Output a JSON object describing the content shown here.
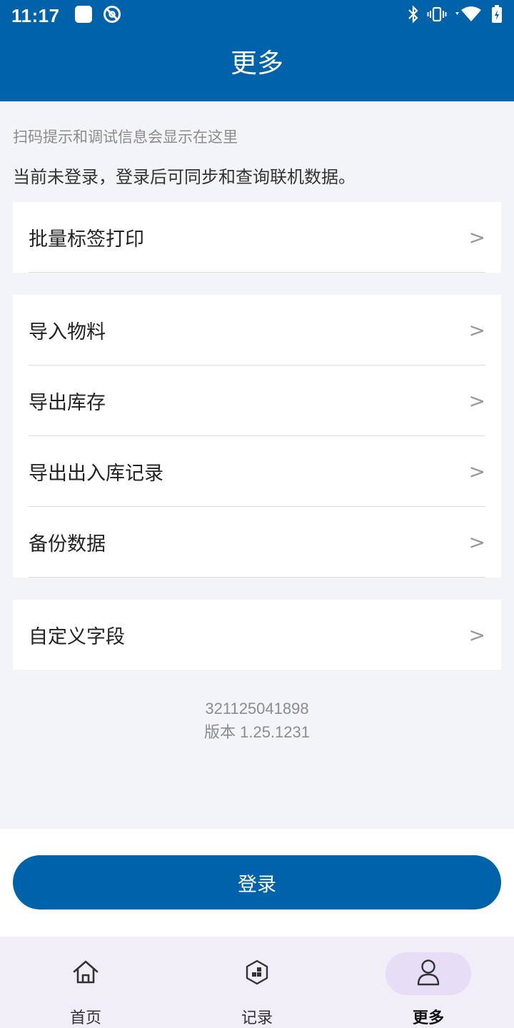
{
  "status_bar": {
    "time": "11:17"
  },
  "header": {
    "title": "更多"
  },
  "hint_text": "扫码提示和调试信息会显示在这里",
  "login_status": "当前未登录，登录后可同步和查询联机数据。",
  "chevron": ">",
  "groups": {
    "print": [
      {
        "label": "批量标签打印"
      }
    ],
    "data": [
      {
        "label": "导入物料"
      },
      {
        "label": "导出库存"
      },
      {
        "label": "导出出入库记录"
      },
      {
        "label": "备份数据"
      }
    ],
    "fields": [
      {
        "label": "自定义字段"
      }
    ]
  },
  "device_id": "321125041898",
  "version": "版本 1.25.1231",
  "login_button": "登录",
  "bottom_nav": [
    {
      "label": "首页",
      "icon": "home-icon"
    },
    {
      "label": "记录",
      "icon": "records-icon"
    },
    {
      "label": "更多",
      "icon": "person-icon",
      "active": true
    }
  ],
  "colors": {
    "primary": "#0062a8",
    "nav_bg": "#f2eef7",
    "nav_active": "#e6def6"
  }
}
